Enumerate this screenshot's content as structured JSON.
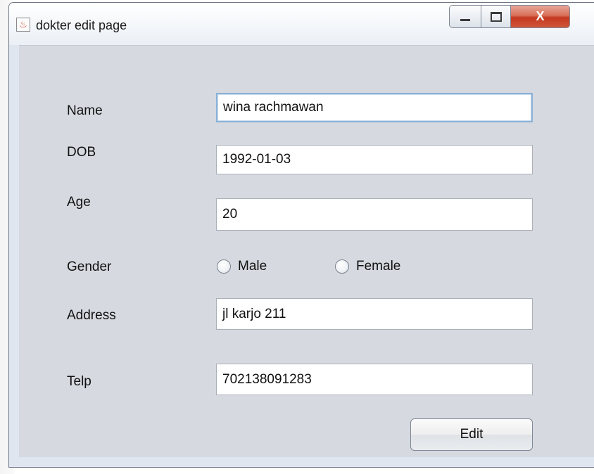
{
  "window": {
    "title": "dokter edit page",
    "close_glyph": "X"
  },
  "form": {
    "name_label": "Name",
    "name_value": "wina rachmawan",
    "dob_label": "DOB",
    "dob_value": "1992-01-03",
    "age_label": "Age",
    "age_value": "20",
    "gender_label": "Gender",
    "gender_options": [
      "Male",
      "Female"
    ],
    "address_label": "Address",
    "address_value": "jl karjo 211",
    "telp_label": "Telp",
    "telp_value": "702138091283"
  },
  "buttons": {
    "edit_label": "Edit"
  },
  "icons": {
    "app": "java-cup-icon",
    "minimize": "minimize-icon",
    "maximize": "maximize-icon",
    "close": "close-icon"
  },
  "colors": {
    "panel_bg": "#d6d9df",
    "close_button": "#c4391f",
    "focus_border": "#8ab2d6"
  }
}
